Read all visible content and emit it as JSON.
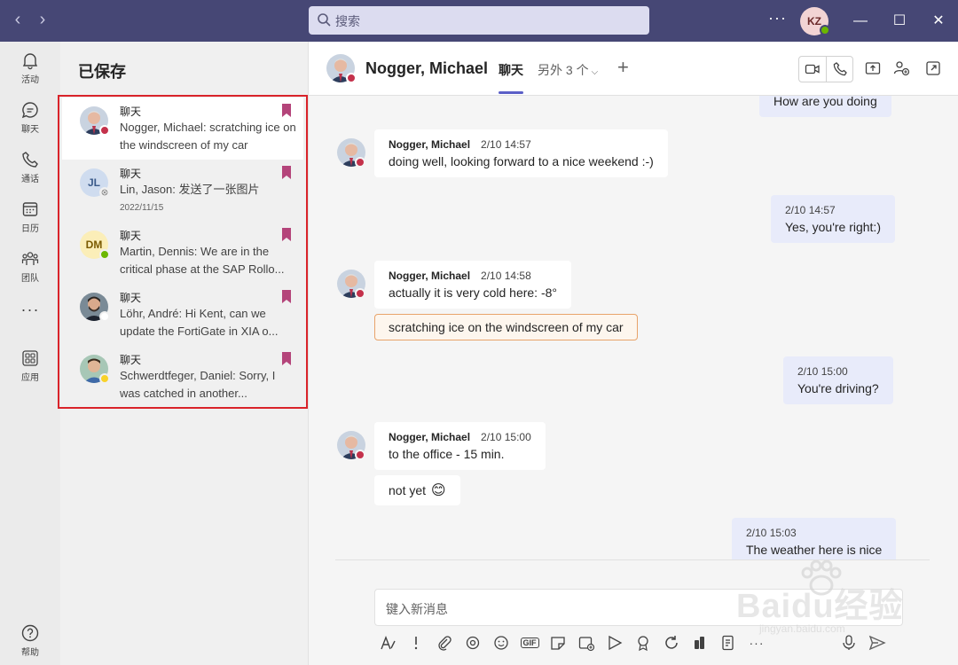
{
  "search": {
    "placeholder": "搜索"
  },
  "titlebar": {
    "more": "···",
    "avatar_initials": "KZ",
    "minimize": "—",
    "maximize": "☐",
    "close": "✕"
  },
  "rail": {
    "items": [
      {
        "label": "活动",
        "icon": "bell-icon"
      },
      {
        "label": "聊天",
        "icon": "chat-icon"
      },
      {
        "label": "通话",
        "icon": "phone-icon"
      },
      {
        "label": "日历",
        "icon": "calendar-icon"
      },
      {
        "label": "团队",
        "icon": "teams-icon"
      },
      {
        "label": "应用",
        "icon": "apps-icon"
      },
      {
        "label": "帮助",
        "icon": "help-icon"
      }
    ],
    "more": "···"
  },
  "saved": {
    "title": "已保存",
    "items": [
      {
        "type": "聊天",
        "text": "Nogger, Michael: scratching ice on the windscreen of my car",
        "status_color": "#c4314b"
      },
      {
        "type": "聊天",
        "text": "Lin, Jason: 发送了一张图片",
        "date": "2022/11/15",
        "initials": "JL",
        "status_color": "#ffffff"
      },
      {
        "type": "聊天",
        "text": "Martin, Dennis: We are in the critical phase at the SAP Rollo...",
        "initials": "DM",
        "status_color": "#6bb700"
      },
      {
        "type": "聊天",
        "text": "Löhr, André: Hi Kent, can we update the FortiGate in XIA o...",
        "status_color": "#ffffff"
      },
      {
        "type": "聊天",
        "text": "Schwerdtfeger, Daniel: Sorry, I was catched in another...",
        "status_color": "#f8d22a"
      }
    ]
  },
  "chat": {
    "name": "Nogger, Michael",
    "tab": "聊天",
    "more": "另外 3 个",
    "plus": "+"
  },
  "messages": {
    "top_partial": "How are you doing",
    "m1": {
      "sender": "Nogger, Michael",
      "time": "2/10 14:57",
      "text": "doing well, looking forward to a nice weekend :-)"
    },
    "m2": {
      "time": "2/10 14:57",
      "text": "Yes, you're right:)"
    },
    "m3": {
      "sender": "Nogger, Michael",
      "time": "2/10 14:58",
      "text": "actually it is very cold here: -8°"
    },
    "m3b": {
      "text": "scratching ice on the windscreen of my car"
    },
    "m4": {
      "time": "2/10 15:00",
      "text": "You're driving?"
    },
    "m5": {
      "sender": "Nogger, Michael",
      "time": "2/10 15:00",
      "text": "to the office - 15 min."
    },
    "m5b": {
      "text": "not yet",
      "emoji": "😊"
    },
    "m6": {
      "time": "2/10 15:03",
      "text": "The weather here is nice"
    }
  },
  "compose": {
    "placeholder": "键入新消息"
  },
  "toolbar": {
    "gif": "GIF",
    "more": "···"
  },
  "watermark": {
    "line1": "Baidu经验",
    "line2": "jingyan.baidu.com"
  }
}
